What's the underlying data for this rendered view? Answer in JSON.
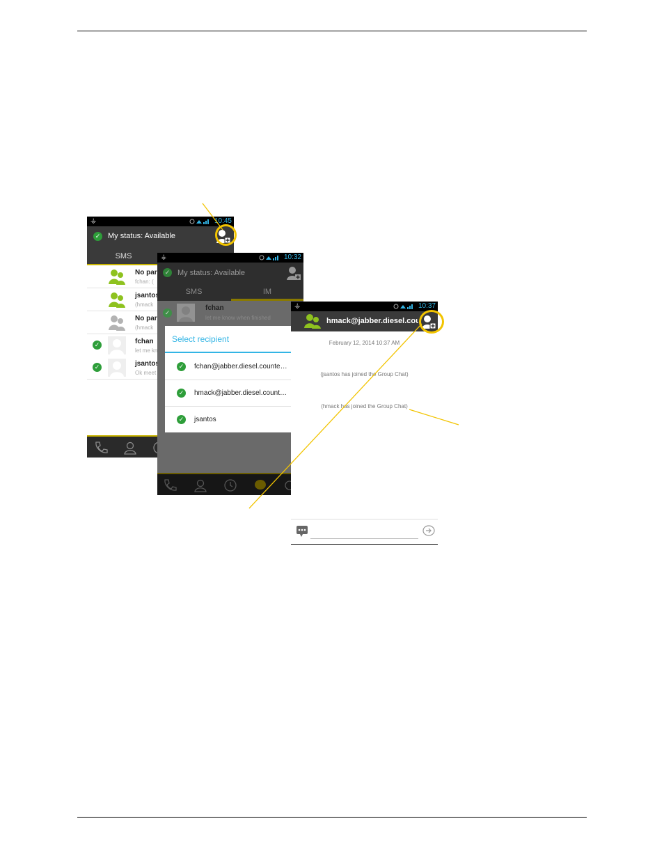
{
  "screen1": {
    "time": "10:45",
    "status_label": "My status: Available",
    "tabs": [
      "SMS",
      "IM"
    ],
    "rows": [
      {
        "title": "No par",
        "subtitle": "fchan: (",
        "avatar": "green-group"
      },
      {
        "title": "jsantos",
        "subtitle": "(hmack",
        "avatar": "green-group"
      },
      {
        "title": "No par",
        "subtitle": "(hmack",
        "avatar": "grey-group"
      },
      {
        "title": "fchan",
        "subtitle": "let me kn",
        "avatar": "blank"
      },
      {
        "title": "jsantos",
        "subtitle": "Ok meet",
        "avatar": "blank"
      }
    ]
  },
  "screen2": {
    "time": "10:32",
    "status_label": "My status: Available",
    "tabs": [
      "SMS",
      "IM"
    ],
    "list_title": "fchan",
    "list_subtitle": "let me know when finished",
    "dialog": {
      "title": "Select recipient",
      "items": [
        "fchan@jabber.diesel.counte…",
        "hmack@jabber.diesel.count…",
        "jsantos"
      ]
    }
  },
  "screen3": {
    "time": "10:37",
    "chat_title": "hmack@jabber.diesel.count",
    "date_line": "February 12, 2014 10:37 AM",
    "messages": [
      "(jsantos has joined the Group Chat)",
      "(hmack has joined the Group Chat)"
    ]
  },
  "colors": {
    "accent_yellow": "#f2c400",
    "status_green": "#2e9e3a",
    "avatar_green": "#8ec21f",
    "dialog_blue": "#33b5e5"
  }
}
